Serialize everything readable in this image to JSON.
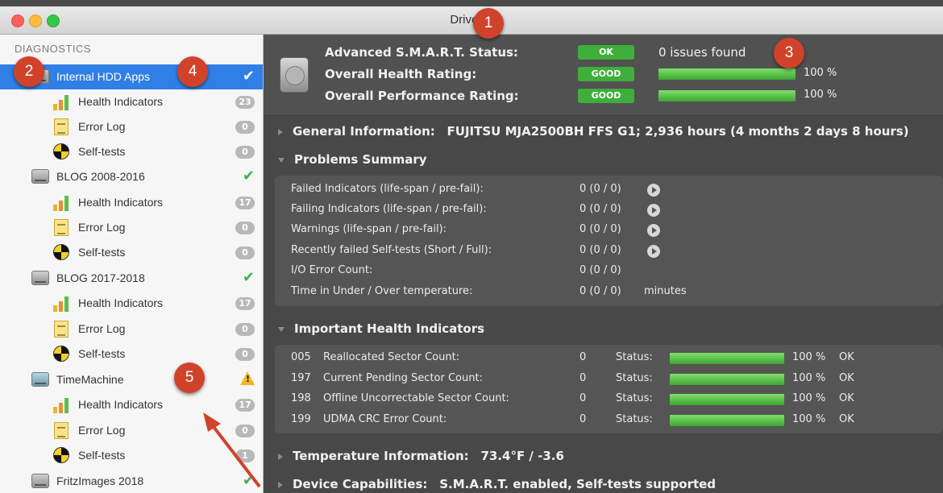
{
  "window": {
    "title": "DriveDx"
  },
  "sidebar": {
    "header": "DIAGNOSTICS",
    "drives": [
      {
        "name": "Internal HDD Apps",
        "status": "ok",
        "children": [
          {
            "label": "Health Indicators",
            "count": "23"
          },
          {
            "label": "Error Log",
            "count": "0"
          },
          {
            "label": "Self-tests",
            "count": "0"
          }
        ]
      },
      {
        "name": "BLOG 2008-2016",
        "status": "ok",
        "children": [
          {
            "label": "Health Indicators",
            "count": "17"
          },
          {
            "label": "Error Log",
            "count": "0"
          },
          {
            "label": "Self-tests",
            "count": "0"
          }
        ]
      },
      {
        "name": "BLOG 2017-2018",
        "status": "ok",
        "children": [
          {
            "label": "Health Indicators",
            "count": "17"
          },
          {
            "label": "Error Log",
            "count": "0"
          },
          {
            "label": "Self-tests",
            "count": "0"
          }
        ]
      },
      {
        "name": "TimeMachine",
        "status": "warning",
        "children": [
          {
            "label": "Health Indicators",
            "count": "17"
          },
          {
            "label": "Error Log",
            "count": "0"
          },
          {
            "label": "Self-tests",
            "count": "1"
          }
        ]
      },
      {
        "name": "FritzImages 2018",
        "status": "ok",
        "children": []
      }
    ]
  },
  "status": {
    "smart_label": "Advanced S.M.A.R.T. Status:",
    "smart_value": "OK",
    "smart_issues": "0 issues found",
    "health_label": "Overall Health Rating:",
    "health_value": "GOOD",
    "health_percent": 100,
    "health_percent_text": "100 %",
    "perf_label": "Overall Performance Rating:",
    "perf_value": "GOOD",
    "perf_percent": 100,
    "perf_percent_text": "100 %"
  },
  "general": {
    "label": "General Information:",
    "value": "FUJITSU MJA2500BH FFS G1; 2,936 hours (4 months 2 days 8 hours)"
  },
  "problems": {
    "title": "Problems Summary",
    "rows": [
      {
        "label": "Failed Indicators (life-span / pre-fail):",
        "value": "0 (0 / 0)",
        "more": true
      },
      {
        "label": "Failing Indicators (life-span / pre-fail):",
        "value": "0 (0 / 0)",
        "more": true
      },
      {
        "label": "Warnings (life-span / pre-fail):",
        "value": "0 (0 / 0)",
        "more": true
      },
      {
        "label": "Recently failed Self-tests (Short / Full):",
        "value": "0 (0 / 0)",
        "more": true
      },
      {
        "label": "I/O Error Count:",
        "value": "0 (0 / 0)",
        "more": false
      },
      {
        "label": "Time in Under / Over temperature:",
        "value": "0 (0 / 0)",
        "suffix": "minutes",
        "more": false
      }
    ]
  },
  "health_indicators": {
    "title": "Important Health Indicators",
    "status_label": "Status:",
    "rows": [
      {
        "id": "005",
        "name": "Reallocated Sector Count:",
        "raw": "0",
        "percent": 100,
        "percent_text": "100 %",
        "state": "OK"
      },
      {
        "id": "197",
        "name": "Current Pending Sector Count:",
        "raw": "0",
        "percent": 100,
        "percent_text": "100 %",
        "state": "OK"
      },
      {
        "id": "198",
        "name": "Offline Uncorrectable Sector Count:",
        "raw": "0",
        "percent": 100,
        "percent_text": "100 %",
        "state": "OK"
      },
      {
        "id": "199",
        "name": "UDMA CRC Error Count:",
        "raw": "0",
        "percent": 100,
        "percent_text": "100 %",
        "state": "OK"
      }
    ]
  },
  "temperature": {
    "label": "Temperature Information:",
    "value": "73.4°F / -3.6"
  },
  "capabilities": {
    "label": "Device Capabilities:",
    "value": "S.M.A.R.T. enabled, Self-tests supported"
  },
  "annotations": [
    "1",
    "2",
    "3",
    "4",
    "5"
  ],
  "colors": {
    "selection": "#2f7fe6",
    "good": "#3eaf3a",
    "annotation": "#d0432a",
    "warning": "#f0b824"
  }
}
